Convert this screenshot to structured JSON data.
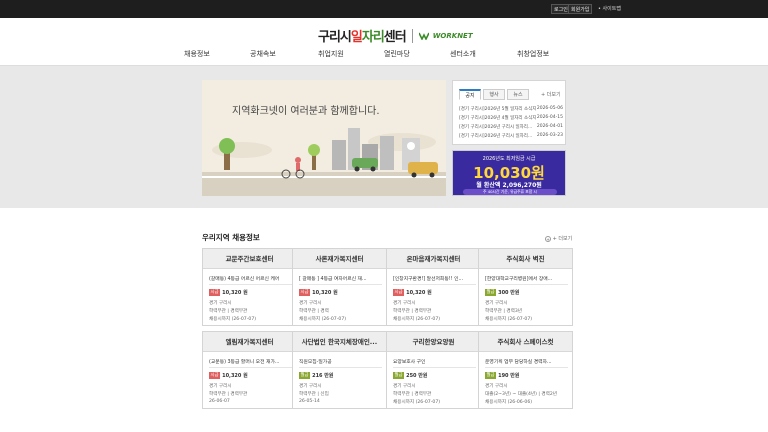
{
  "topbar": {
    "login": "로그인",
    "join": "회원가입",
    "sitemap": "• 사이트맵"
  },
  "logo": {
    "brand_pre": "구리시",
    "brand_hl1": "일",
    "brand_hl2": "자리",
    "brand_post": "센터",
    "worknet": "WORKNET"
  },
  "nav": [
    "채용정보",
    "공채속보",
    "취업지원",
    "열린마당",
    "센터소개",
    "취창업정보"
  ],
  "banner": {
    "slogan": "지역화크넷이 여러분과 함께합니다."
  },
  "notice": {
    "tabs": [
      "공지",
      "행사",
      "뉴스"
    ],
    "more": "+ 더보기",
    "items": [
      {
        "title": "[경기 구리시]2026년 5월 일자리 소식지",
        "date": "2026-05-06"
      },
      {
        "title": "[경기 구리시]2026년 4월 일자리 소식지",
        "date": "2026-04-15"
      },
      {
        "title": "[경기 구리시]2026년 구리시 일자리...",
        "date": "2026-04-01"
      },
      {
        "title": "[경기 구리시]2026년 구리시 일자리...",
        "date": "2026-03-23"
      }
    ]
  },
  "promo": {
    "line1": "2026년도 최저임금 시급",
    "amount": "10,030원",
    "monthly": "월 환산액 2,096,270원",
    "note": "주 40시간 기준, 유급주휴 포함 시"
  },
  "jobs": {
    "title": "우리지역 채용정보",
    "more": "+ 더보기",
    "cards": [
      {
        "company": "교문주간보호센터",
        "desc": "(갈매동) 4등급 어르신 어르신 케어",
        "pay_type": "시급",
        "pay": "10,320 원",
        "loc": "경기 구리시",
        "career": "학력무관 | 경력무관",
        "deadline": "채용시까지 (26-07-07)"
      },
      {
        "company": "사론재가복지센터",
        "desc": "[ 갈매동 ] 4등급 여자어르신 재...",
        "pay_type": "시급",
        "pay": "10,320 원",
        "loc": "경기 구리시",
        "career": "학력무관 | 경력",
        "deadline": "채용시까지 (26-07-07)"
      },
      {
        "company": "온마음재가복지센터",
        "desc": "[인창지구환경!] 알선저희동!! 인...",
        "pay_type": "시급",
        "pay": "10,320 원",
        "loc": "경기 구리시",
        "career": "학력무관 | 경력무관",
        "deadline": "채용시까지 (26-07-07)"
      },
      {
        "company": "주식회사 벽진",
        "desc": "[한양대학교구리병원]에서 장애...",
        "pay_type": "월급",
        "pay": "300 만원",
        "loc": "경기 구리시",
        "career": "학력무관 | 경력3년",
        "deadline": "채용시까지 (26-07-07)"
      },
      {
        "company": "엘림재가복지센터",
        "desc": "(교문동) 3등급 할머니 오전 재가...",
        "pay_type": "시급",
        "pay": "10,320 원",
        "loc": "경기 구리시",
        "career": "학력무관 | 경력무관",
        "deadline": "26-06-07"
      },
      {
        "company": "사단법인 한국지체장애인...",
        "desc": "직원모집-일가공",
        "pay_type": "월급",
        "pay": "216 만원",
        "loc": "경기 구리시",
        "career": "학력무관 | 신입",
        "deadline": "26-05-14"
      },
      {
        "company": "구리한양요양원",
        "desc": "요양보호사 구인",
        "pay_type": "월급",
        "pay": "250 만원",
        "loc": "경기 구리시",
        "career": "학력무관 | 경력무관",
        "deadline": "채용시까지 (26-07-07)"
      },
      {
        "company": "주식회사 스페이스컷",
        "desc": "운영기획 업무 담당하실 경력자...",
        "pay_type": "월급",
        "pay": "190 만원",
        "loc": "경기 구리시",
        "career": "대졸(2~3년) ~ 대졸(4년) | 경력2년",
        "deadline": "채용시까지 (26-06-06)"
      }
    ]
  },
  "colors": {
    "topbar": "#1e1e1e",
    "accent_red": "#e8302a",
    "accent_green": "#3b8b28",
    "promo_bg": "#3a2aa0",
    "promo_amount": "#ffd83a"
  }
}
